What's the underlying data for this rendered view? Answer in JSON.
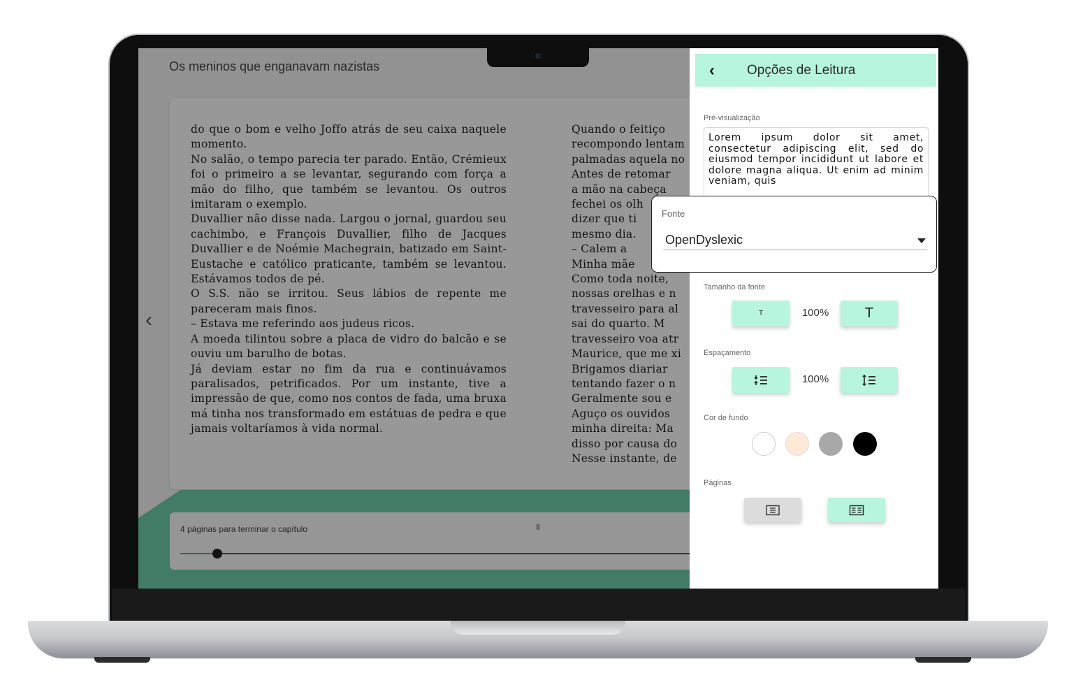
{
  "reader": {
    "book_title": "Os meninos que enganavam nazistas",
    "left_page": "do que o bom e velho Joffo atrás de seu caixa naquele momento.\n No salão, o tempo parecia ter parado. Então, Crémieux foi o primeiro a se levantar, segurando com força a mão do filho, que também se levantou. Os outros imitaram o exemplo.\n Duvallier não disse nada. Largou o jornal, guardou seu cachimbo, e François Duvallier, filho de Jacques Duvallier e de Noémie Machegrain, batizado em Saint-Eustache e católico praticante, também se levantou. Estávamos todos de pé.\n O S.S. não se irritou. Seus lábios de repente me pareceram mais finos.\n – Estava me referindo aos judeus ricos.\n A moeda tilintou sobre a placa de vidro do balcão e se ouviu um barulho de botas.\n Já deviam estar no fim da rua e continuávamos paralisados, petrificados. Por um instante, tive a impressão de que, como nos contos de fada, uma bruxa má tinha nos transformado em estátuas de pedra e que jamais voltaríamos à vida normal.",
    "right_page": " Quando o feitiço\nrecompondo lentam\npalmadas aquela no\n Antes de retomar\na mão na cabeça\nfechei os olh\ndizer que ti\nmesmo dia.\n – Calem a\nMinha mãe\n Como toda noite,\nnossas orelhas e n\ntravesseiro para al\nsai do quarto. M\ntravesseiro voa atr\nMaurice, que me xi\n Brigamos diariar\ntentando fazer o n\n Geralmente sou e\n Aguço os ouvidos\nminha direita: Ma\ndisso por causa do\nNesse instante, de",
    "prev_icon": "chevron-left-icon",
    "progress_label": "4 páginas para terminar o capítulo",
    "pause_icon": "pause-icon",
    "progress_fraction": 0.05
  },
  "panel": {
    "title": "Opções de Leitura",
    "back_icon": "chevron-left-icon",
    "preview_label": "Pré-visualização",
    "preview_text": "Lorem ipsum dolor sit amet, consectetur adipiscing elit, sed do eiusmod tempor incididunt ut labore et dolore magna aliqua. Ut enim ad minim veniam, quis",
    "font_label": "Fonte",
    "font_value": "OpenDyslexic",
    "font_size_label": "Tamanho da fonte",
    "font_size_small": "T",
    "font_size_large": "T",
    "font_size_value": "100%",
    "spacing_label": "Espaçamento",
    "spacing_value": "100%",
    "background_label": "Cor de fundo",
    "background_colors": [
      "#ffffff",
      "#fde9d6",
      "#a8a8a8",
      "#000000"
    ],
    "pages_label": "Páginas",
    "accent_color": "#b7f5dc"
  }
}
